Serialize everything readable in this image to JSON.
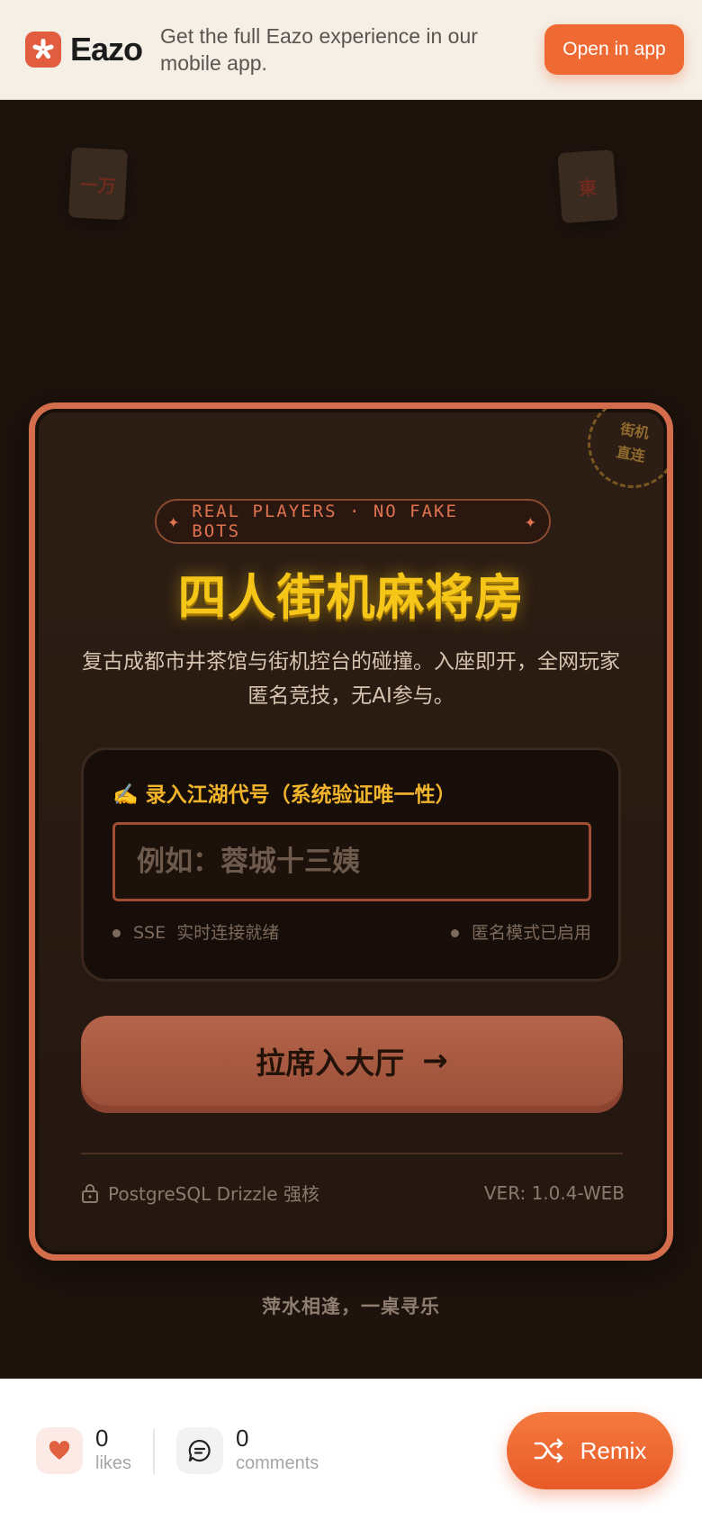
{
  "banner": {
    "brand_name": "Eazo",
    "message": "Get the full Eazo experience in our mobile app.",
    "open_label": "Open in app"
  },
  "tiles": [
    "一万",
    "東"
  ],
  "card": {
    "stamp": "街机\n直连",
    "pill": "REAL PLAYERS · NO FAKE BOTS",
    "title": "四人街机麻将房",
    "subtitle": "复古成都市井茶馆与街机控台的碰撞。入座即开，全网玩家匿名竞技，无AI参与。",
    "input_label": "✍️ 录入江湖代号（系统验证唯一性）",
    "input_placeholder": "例如：蓉城十三姨",
    "input_value": "",
    "status_left": "SSE  实时连接就绪",
    "status_right": "匿名模式已启用",
    "enter_label": "拉席入大厅",
    "enter_arrow": "→",
    "footer_left": "PostgreSQL Drizzle 强核",
    "footer_right": "VER: 1.0.4-WEB"
  },
  "tagline": "萍水相逢，一桌寻乐",
  "bottom": {
    "likes_count": "0",
    "likes_label": "likes",
    "comments_count": "0",
    "comments_label": "comments",
    "remix_label": "Remix"
  },
  "colors": {
    "accent": "#ef6a33",
    "card_border": "#d36d4c",
    "title_gold": "#f5c518",
    "background": "#1e130d"
  },
  "icons": [
    "eazo-logo-icon",
    "sparkle-icon",
    "lock-icon",
    "heart-icon",
    "comment-icon",
    "shuffle-icon"
  ]
}
